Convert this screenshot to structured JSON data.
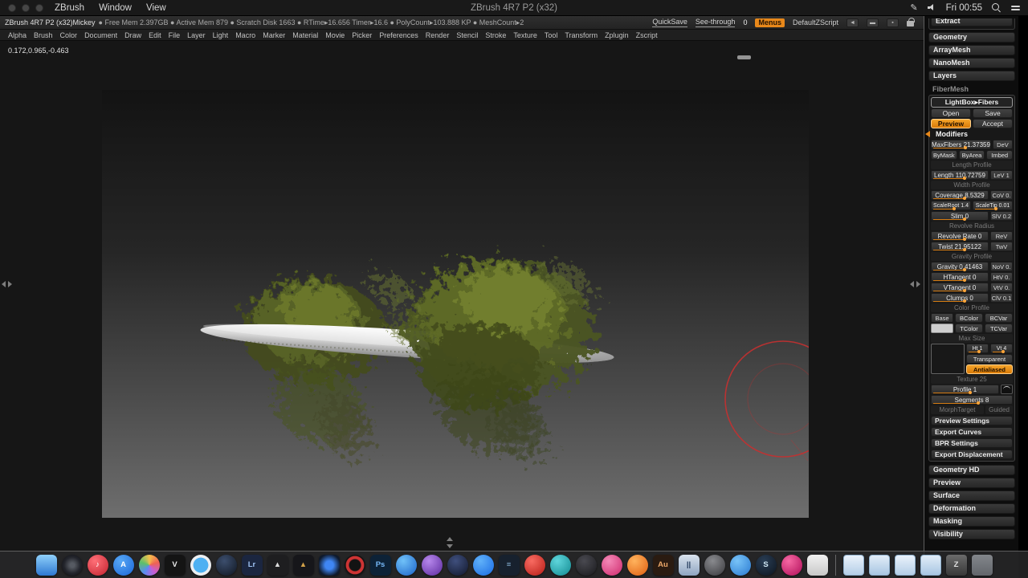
{
  "menubar": {
    "menus": [
      "ZBrush",
      "Window",
      "View"
    ],
    "window_title": "ZBrush 4R7 P2 (x32)",
    "clock": "Fri 00:55"
  },
  "statusbar": {
    "app": "ZBrush 4R7 P2 (x32)Mickey",
    "stats": "● Free Mem 2.397GB ● Active Mem 879 ● Scratch Disk 1663 ● RTime▸16.656 Timer▸16.6 ● PolyCount▸103.888 KP ● MeshCount▸2",
    "quicksave": "QuickSave",
    "see_through": "See-through",
    "see_through_value": "0",
    "menus_btn": "Menus",
    "zscript": "DefaultZScript"
  },
  "menu_row": [
    "Alpha",
    "Brush",
    "Color",
    "Document",
    "Draw",
    "Edit",
    "File",
    "Layer",
    "Light",
    "Macro",
    "Marker",
    "Material",
    "Movie",
    "Picker",
    "Preferences",
    "Render",
    "Stencil",
    "Stroke",
    "Texture",
    "Tool",
    "Transform",
    "Zplugin",
    "Zscript"
  ],
  "canvas": {
    "coords": "0.172,0.965,-0.463"
  },
  "colors": {
    "accent": "#e8881a",
    "brush_ring": "#c53030",
    "fiber_green_dark": "#434c1c",
    "fiber_green_mid": "#5c6526",
    "fiber_green_light": "#7d8a31",
    "disc_light": "#fdfdfd",
    "canvas_top": "#131313",
    "canvas_bottom": "#6e6e6e"
  },
  "tray": {
    "extract": "Extract",
    "sections_top": [
      "Geometry",
      "ArrayMesh",
      "NanoMesh",
      "Layers"
    ],
    "fibermesh_header": "FiberMesh",
    "fm": {
      "lightbox": "LightBox▸Fibers",
      "open": "Open",
      "save": "Save",
      "preview": "Preview",
      "accept": "Accept",
      "modifiers": "Modifiers",
      "maxfibers": "MaxFibers 21.37359",
      "maxfibers_side": "DeV",
      "bymask": "ByMask",
      "byarea": "ByArea",
      "imbed": "Imbed",
      "length_profile": "Length Profile",
      "length": "Length 110.72759",
      "length_side": "LeV 1",
      "width_profile": "Width Profile",
      "coverage": "Coverage 8.5329",
      "coverage_side": "CoV 0.",
      "scaleroot": "ScaleRoot 1.4",
      "scaletip": "ScaleTip 0.01",
      "slim": "Slim 0",
      "slim_side": "SlV 0.2",
      "revolve_radius": "Revolve Radius",
      "revolve_rate": "Revolve Rate 0",
      "revolve_side": "ReV",
      "twist": "Twist 21.95122",
      "twist_side": "TwV",
      "gravity_profile": "Gravity Profile",
      "gravity": "Gravity 0.41463",
      "gravity_side": "NoV 0.",
      "htangent": "HTangent 0",
      "htangent_side": "HtV 0.",
      "vtangent": "VTangent 0",
      "vtangent_side": "VtV 0.",
      "clumps": "Clumps 0",
      "clumps_side": "ClV 0.1",
      "color_profile": "Color Profile",
      "base": "Base",
      "bcolor": "BColor",
      "bcvar": "BCVar",
      "tcolor": "TColor",
      "tcvar": "TCVar",
      "max_size": "Max Size",
      "ht": "Ht 1",
      "vt": "Vt 4",
      "transparent": "Transparent",
      "antialiased": "Antialiased",
      "texture": "Texture 25",
      "profile": "Profile 1",
      "segments": "Segments 8",
      "morphtarget": "MorphTarget",
      "guided": "Guided",
      "preview_settings": "Preview Settings",
      "export_curves": "Export Curves",
      "bpr_settings": "BPR Settings",
      "export_displacement": "Export Displacement"
    },
    "sections_bottom": [
      "Geometry HD",
      "Preview",
      "Surface",
      "Deformation",
      "Masking",
      "Visibility"
    ]
  },
  "dock": {
    "items": [
      {
        "name": "dock-finder",
        "cls": "dk",
        "style": "border-radius:6px;background:linear-gradient(180deg,#8fd0fa,#2e78d2)",
        "glyph": "",
        "inter": "true"
      },
      {
        "name": "dock-lens-app",
        "cls": "dk",
        "style": "border-radius:50%;background:radial-gradient(circle,#565a62 15%,#23252c 55%,#0b0c10 100%)",
        "glyph": "",
        "inter": "true"
      },
      {
        "name": "dock-music",
        "cls": "dk",
        "style": "border-radius:50%;background:radial-gradient(circle at 35% 30%,#ff7078,#c2212e);color:#fff",
        "glyph": "♪",
        "inter": "true"
      },
      {
        "name": "dock-app-store",
        "cls": "dk",
        "style": "border-radius:50%;background:radial-gradient(circle at 35% 30%,#58a8f5,#1a66d8);color:#fff",
        "glyph": "A",
        "inter": "true"
      },
      {
        "name": "dock-photos",
        "cls": "dk",
        "style": "border-radius:50%;background:conic-gradient(#f5c04c,#ee6252,#c65cd5,#5a8df1,#5cbf6b,#f5c04c)",
        "glyph": "",
        "inter": "true"
      },
      {
        "name": "dock-dark-v-app",
        "cls": "dk",
        "style": "border-radius:6px;background:#141414;color:#ececec",
        "glyph": "V",
        "inter": "true"
      },
      {
        "name": "dock-safari",
        "cls": "dk",
        "style": "border-radius:50%;background:radial-gradient(circle,#4db0f2 0 50%,#eceff2 52% 70%,#aeb6bd 100%)",
        "glyph": "",
        "inter": "true"
      },
      {
        "name": "dock-dark-sphere-app",
        "cls": "dk",
        "style": "border-radius:50%;background:radial-gradient(circle at 40% 30%,#3c4e6d,#0f1621)",
        "glyph": "",
        "inter": "true"
      },
      {
        "name": "dock-lightroom",
        "cls": "dk",
        "style": "border-radius:6px;background:#1b2640;color:#9dc1f1",
        "glyph": "Lr",
        "inter": "true"
      },
      {
        "name": "dock-silver-triangle-app",
        "cls": "dk",
        "style": "border-radius:6px;background:#1e1e20;color:#dcdcdc",
        "glyph": "▲",
        "inter": "true"
      },
      {
        "name": "dock-gold-triangle-app",
        "cls": "dk",
        "style": "border-radius:6px;background:#16161a;color:#d1a149",
        "glyph": "▲",
        "inter": "true"
      },
      {
        "name": "dock-blue-glow-app",
        "cls": "dk",
        "style": "border-radius:6px;background:radial-gradient(circle,#3f86f4 0 28%,#0f1a2c 75%)",
        "glyph": "",
        "inter": "true"
      },
      {
        "name": "dock-red-ring-app",
        "cls": "dk",
        "style": "border-radius:50%;background:radial-gradient(circle,#131313 0 38%,#ce3434 44% 60%,#131313 64%)",
        "glyph": "",
        "inter": "true"
      },
      {
        "name": "dock-photoshop",
        "cls": "dk",
        "style": "border-radius:6px;background:#0d2237;color:#75b7f6",
        "glyph": "Ps",
        "inter": "true"
      },
      {
        "name": "dock-blue-sphere-app",
        "cls": "dk",
        "style": "border-radius:50%;background:radial-gradient(circle at 35% 30%,#70c1f8,#1b62c8)",
        "glyph": "",
        "inter": "true"
      },
      {
        "name": "dock-purple-sphere-app",
        "cls": "dk",
        "style": "border-radius:50%;background:radial-gradient(circle at 35% 30%,#b687eb,#5c2a9f)",
        "glyph": "",
        "inter": "true"
      },
      {
        "name": "dock-navy-sphere-app",
        "cls": "dk",
        "style": "border-radius:50%;background:radial-gradient(circle at 40% 30%,#3f4f7d,#11172b)",
        "glyph": "",
        "inter": "true"
      },
      {
        "name": "dock-blue-chat-app",
        "cls": "dk",
        "style": "border-radius:50%;background:radial-gradient(circle at 35% 30%,#60b1f9,#1a6be3)",
        "glyph": "",
        "inter": "true"
      },
      {
        "name": "dock-dark-blue-list-app",
        "cls": "dk",
        "style": "border-radius:6px;background:#17212e;color:#7fa7c7",
        "glyph": "≡",
        "inter": "true"
      },
      {
        "name": "dock-red-sphere-app",
        "cls": "dk",
        "style": "border-radius:50%;background:radial-gradient(circle at 35% 30%,#f86b61,#b71c16)",
        "glyph": "",
        "inter": "true"
      },
      {
        "name": "dock-teal-sphere-app",
        "cls": "dk",
        "style": "border-radius:50%;background:radial-gradient(circle at 35% 30%,#5ed5db,#128a91)",
        "glyph": "",
        "inter": "true"
      },
      {
        "name": "dock-gray-sphere-app",
        "cls": "dk",
        "style": "border-radius:50%;background:radial-gradient(circle at 40% 30%,#494950,#19191c)",
        "glyph": "",
        "inter": "true"
      },
      {
        "name": "dock-pink-sphere-app",
        "cls": "dk",
        "style": "border-radius:50%;background:radial-gradient(circle at 35% 30%,#f489b7,#ce296d)",
        "glyph": "",
        "inter": "true"
      },
      {
        "name": "dock-orange-sphere-app",
        "cls": "dk",
        "style": "border-radius:50%;background:radial-gradient(circle at 35% 30%,#ffb35d,#df5e10)",
        "glyph": "",
        "inter": "true"
      },
      {
        "name": "dock-audition",
        "cls": "dk",
        "style": "border-radius:6px;background:#2a1b11;color:#eca86a",
        "glyph": "Au",
        "inter": "true"
      },
      {
        "name": "dock-vm-app",
        "cls": "dk",
        "style": "border-radius:6px;background:linear-gradient(180deg,#dae3ee,#8fa5c1);color:#22395a",
        "glyph": "||",
        "inter": "true"
      },
      {
        "name": "dock-gray-circle-app",
        "cls": "dk",
        "style": "border-radius:50%;background:radial-gradient(circle at 40% 30%,#898a8e,#39393d)",
        "glyph": "",
        "inter": "true"
      },
      {
        "name": "dock-blue-circle-app",
        "cls": "dk",
        "style": "border-radius:50%;background:radial-gradient(circle at 35% 30%,#78c3f7,#2a7ad1)",
        "glyph": "",
        "inter": "true"
      },
      {
        "name": "dock-steam",
        "cls": "dk",
        "style": "border-radius:50%;background:radial-gradient(circle at 40% 30%,#293d54,#0d151f);color:#d0e7f3",
        "glyph": "S",
        "inter": "true"
      },
      {
        "name": "dock-magenta-sphere-app",
        "cls": "dk",
        "style": "border-radius:50%;background:radial-gradient(circle at 35% 30%,#f668a3,#af0c58)",
        "glyph": "",
        "inter": "true"
      },
      {
        "name": "dock-light-gray-app",
        "cls": "dk",
        "style": "border-radius:6px;background:linear-gradient(180deg,#f1f1f1,#c8c8c8)",
        "glyph": "",
        "inter": "true"
      },
      {
        "name": "dock-divider",
        "cls": "dkdiv",
        "style": "",
        "glyph": "",
        "inter": "false"
      },
      {
        "name": "dock-minimized-window-1",
        "cls": "dk",
        "style": "border-radius:4px;background:linear-gradient(180deg,#eaf2fb,#b4cee7);border:1px solid #8fb0cc",
        "glyph": "",
        "inter": "true"
      },
      {
        "name": "dock-minimized-window-2",
        "cls": "dk",
        "style": "border-radius:4px;background:linear-gradient(180deg,#e2edf8,#a8c6e2);border:1px solid #8fb0cc",
        "glyph": "",
        "inter": "true"
      },
      {
        "name": "dock-minimized-window-3",
        "cls": "dk",
        "style": "border-radius:4px;background:linear-gradient(180deg,#eaf2fb,#b4cee7);border:1px solid #8fb0cc",
        "glyph": "",
        "inter": "true"
      },
      {
        "name": "dock-minimized-window-4",
        "cls": "dk",
        "style": "border-radius:4px;background:linear-gradient(180deg,#e2edf8,#a8c6e2);border:1px solid #8fb0cc",
        "glyph": "",
        "inter": "true"
      },
      {
        "name": "dock-zbrush-document",
        "cls": "dk",
        "style": "border-radius:4px;background:linear-gradient(180deg,#6b6b6b,#383838);color:#e0e0e0",
        "glyph": "Z",
        "inter": "true"
      },
      {
        "name": "dock-trash",
        "cls": "dk",
        "style": "border-radius:4px;background:linear-gradient(180deg,rgba(210,216,224,.55),rgba(150,156,165,.55))",
        "glyph": "",
        "inter": "true"
      }
    ]
  }
}
